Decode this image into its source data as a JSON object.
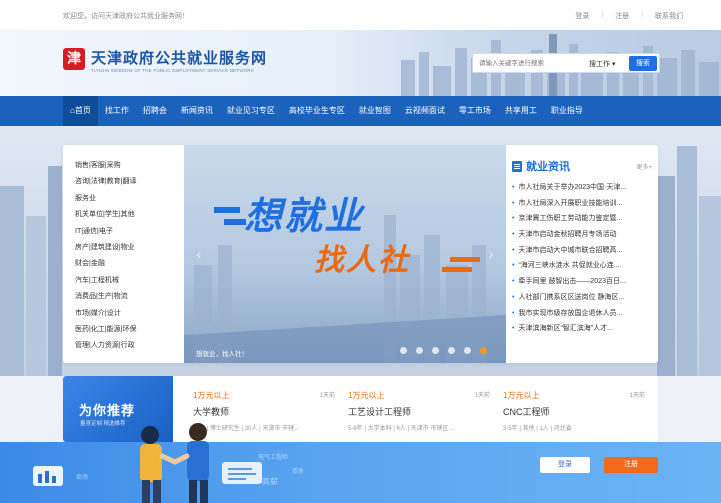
{
  "topbar": {
    "welcome": "欢迎您，访问天津政府公共就业服务网！",
    "links": [
      "登录",
      "注册",
      "联系我们"
    ]
  },
  "header": {
    "logo_char": "津",
    "brand": "天津政府公共就业服务网",
    "brand_en": "TIANJIN WEBDOM OF THE PUBLIC EMPLOYMENT SERVICE NETWORK",
    "search_placeholder": "请输入关键字进行搜索",
    "search_type": "搜工作",
    "search_button": "搜索"
  },
  "nav": {
    "items": [
      "首页",
      "找工作",
      "招聘会",
      "新闻资讯",
      "就业见习专区",
      "高校毕业生专区",
      "就业智图",
      "云视频面试",
      "零工市场",
      "共享用工",
      "职业指导"
    ]
  },
  "categories": [
    "销售|客服|采购",
    "咨询|法律|教育|翻译",
    "服务业",
    "机关单位|学生|其他",
    "IT|通信|电子",
    "房产|建筑建设|物业",
    "财会|金融",
    "汽车|工程机械",
    "消费品|生产|物流",
    "市场|媒介|设计",
    "医药|化工|能源|环保",
    "管理|人力资源|行政"
  ],
  "banner": {
    "slogan1": "想就业",
    "slogan2": "找人社",
    "caption": "想就业，找人社！",
    "slide_count": 6,
    "active_slide": 6
  },
  "news": {
    "title": "就业资讯",
    "more": "更多+",
    "items": [
      "市人社局关于举办2023中国·天津...",
      "市人社局深入开展职业技能培训...",
      "京津冀工伤职工劳动能力鉴定暨...",
      "天津市启动金秋招聘月专场活动",
      "天津市启动大中城市联合招聘高...",
      "“海河三峡水涟水 共促就业心连...",
      "牵手同里 鼓智出击——2023百日...",
      "人社部门携系区区送岗位 静海区...",
      "我市实现市级存放国企退休人员...",
      "天津滨海新区“智汇滨海”人才..."
    ]
  },
  "recommend": {
    "title": "为你推荐",
    "subtitle": "量身定制 精选推荐",
    "jobs": [
      {
        "salary": "1万元以上",
        "days": "1天前",
        "title": "大学教师",
        "meta": "不限 | 博士研究生 | 30人 | 天津市 市辖..."
      },
      {
        "salary": "1万元以上",
        "days": "1天前",
        "title": "工艺设计工程师",
        "meta": "5-8年 | 大学本科 | 6人 | 天津市 市辖区 ..."
      },
      {
        "salary": "1万元以上",
        "days": "1天前",
        "title": "CNC工程师",
        "meta": "3-5年 | 其他 | 1人 | 河北省"
      }
    ]
  },
  "footer": {
    "login": "登录",
    "register": "注册",
    "floats": [
      "商场",
      "电气工程师",
      "双休",
      "高薪"
    ]
  },
  "colors": {
    "nav": "#1a62bc",
    "brand": "#1f55a5",
    "accent_orange": "#f26a1b",
    "accent_blue": "#1f6fe0"
  }
}
